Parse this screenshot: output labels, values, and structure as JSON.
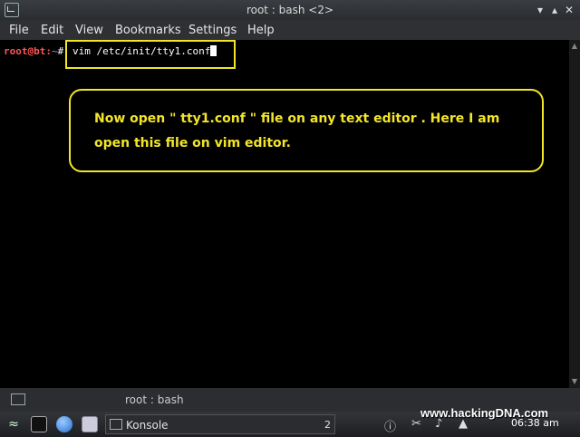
{
  "window": {
    "title": "root : bash <2>"
  },
  "menu": {
    "items": [
      "File",
      "Edit",
      "View",
      "Bookmarks",
      "Settings",
      "Help"
    ]
  },
  "terminal": {
    "user": "root",
    "at": "@",
    "host": "bt",
    "colon": ":",
    "path": "~",
    "symbol": "#",
    "command": "vim /etc/init/tty1.conf"
  },
  "callout": {
    "text": "Now open \" tty1.conf \" file on any text editor . Here I am open this file on vim editor."
  },
  "tab": {
    "label": "root : bash"
  },
  "taskbar": {
    "task_label": "Konsole",
    "task_count": "2",
    "clock": "06:38 am"
  },
  "watermark": "www.hackingDNA.com",
  "colors": {
    "highlight": "#f2e52a",
    "prompt_user": "#ff5555",
    "prompt_path": "#9999ff"
  }
}
